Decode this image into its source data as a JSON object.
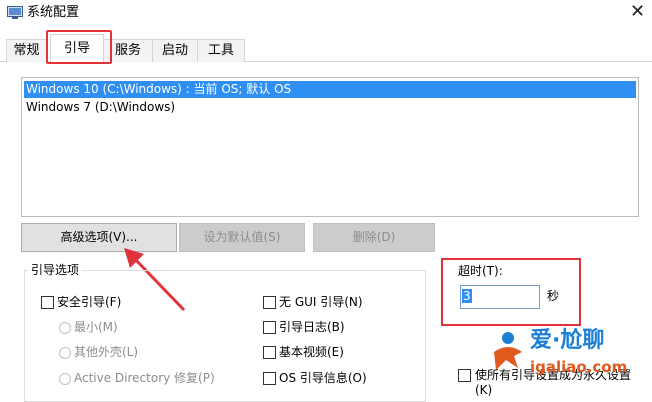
{
  "window": {
    "title": "系统配置"
  },
  "tabs": [
    "常规",
    "引导",
    "服务",
    "启动",
    "工具"
  ],
  "os_list": [
    "Windows 10 (C:\\Windows) : 当前 OS; 默认 OS",
    "Windows 7 (D:\\Windows)"
  ],
  "buttons": {
    "advanced": "高级选项(V)...",
    "set_default": "设为默认值(S)",
    "delete": "删除(D)"
  },
  "boot_options": {
    "title": "引导选项",
    "safe_boot": "安全引导(F)",
    "minimal": "最小(M)",
    "alternate_shell": "其他外壳(L)",
    "active_directory": "Active Directory 修复(P)",
    "no_gui": "无 GUI 引导(N)",
    "boot_log": "引导日志(B)",
    "base_video": "基本视频(E)",
    "os_boot_info": "OS 引导信息(O)"
  },
  "timeout": {
    "label": "超时(T):",
    "value": "3",
    "unit": "秒"
  },
  "make_permanent": {
    "line1": "使所有引导设置成为永久设置",
    "line2": "(K)"
  },
  "watermark": {
    "brand": "爱·尬聊",
    "url": "igaliao.com"
  },
  "colors": {
    "accent": "#e0333a",
    "selection": "#2f8ff2"
  }
}
